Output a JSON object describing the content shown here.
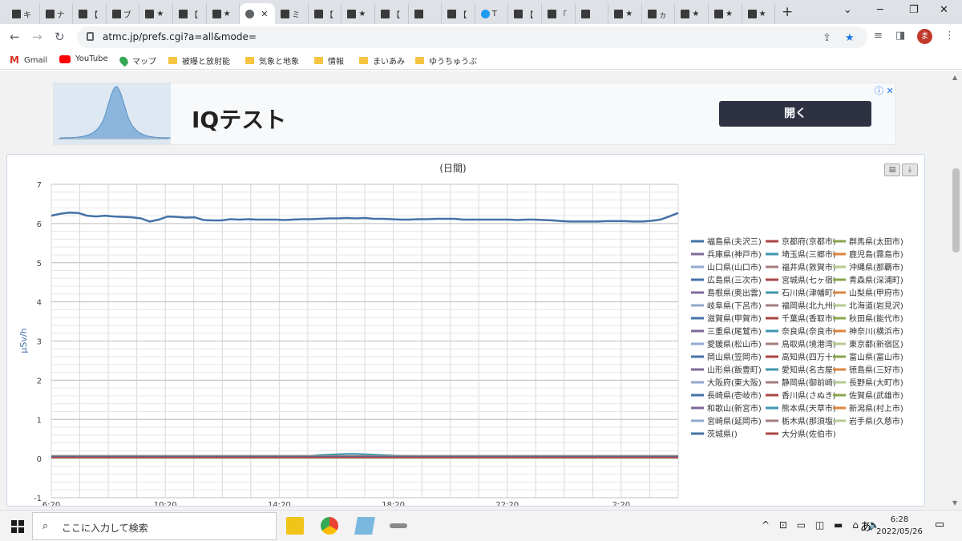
{
  "browser": {
    "tabs": [
      {
        "text": "キ",
        "icon": "app-tile-icon"
      },
      {
        "text": "ナ",
        "icon": "app-tile-icon"
      },
      {
        "text": "【",
        "icon": "app-tile-icon"
      },
      {
        "text": "ブ",
        "icon": "info-circle-icon"
      },
      {
        "text": "★",
        "icon": "app-tile-icon"
      },
      {
        "text": "【",
        "icon": "app-tile-icon"
      },
      {
        "text": "★",
        "icon": "app-tile-icon"
      },
      {
        "text": "",
        "icon": "globe-icon",
        "active": true
      },
      {
        "text": "ミ",
        "icon": "app-tile-icon"
      },
      {
        "text": "【",
        "icon": "app-tile-icon"
      },
      {
        "text": "★",
        "icon": "app-tile-icon"
      },
      {
        "text": "【",
        "icon": "app-tile-icon"
      },
      {
        "text": "",
        "icon": "app-tile-icon"
      },
      {
        "text": "【",
        "icon": "app-tile-icon"
      },
      {
        "text": "T",
        "icon": "twitter-icon"
      },
      {
        "text": "【",
        "icon": "app-tile-icon"
      },
      {
        "text": "「",
        "icon": "app-tile-icon"
      },
      {
        "text": "",
        "icon": "app-tile-icon"
      },
      {
        "text": "★",
        "icon": "app-tile-icon"
      },
      {
        "text": "ヵ",
        "icon": "app-tile-icon"
      },
      {
        "text": "★",
        "icon": "app-tile-icon"
      },
      {
        "text": "★",
        "icon": "app-tile-icon"
      },
      {
        "text": "★",
        "icon": "app-tile-icon"
      }
    ],
    "url": "atmc.jp/prefs.cgi?a=all&mode=",
    "avatar_letter": "ま",
    "bookmarks": [
      "Gmail",
      "YouTube",
      "マップ",
      "被曝と放射能",
      "気象と地象",
      "情報",
      "まいあみ",
      "ゆうちゅうぶ"
    ]
  },
  "ad": {
    "title": "IQテスト",
    "button": "開く"
  },
  "chart_data": {
    "type": "line",
    "title": "(日間)",
    "xlabel": "",
    "ylabel": "μSv/h",
    "ylim": [
      -1,
      7
    ],
    "yticks": [
      -1,
      0,
      1,
      2,
      3,
      4,
      5,
      6,
      7
    ],
    "x_tick_labels": [
      "6:20",
      "10:20",
      "14:20",
      "18:20",
      "22:20",
      "2:20"
    ],
    "grid": true,
    "legend_position": "right",
    "series": [
      {
        "name": "福島県(夫沢三)",
        "color": "#4572a7",
        "values": [
          6.2,
          6.25,
          6.28,
          6.27,
          6.2,
          6.18,
          6.2,
          6.18,
          6.17,
          6.16,
          6.13,
          6.05,
          6.1,
          6.18,
          6.17,
          6.15,
          6.16,
          6.09,
          6.08,
          6.08,
          6.11,
          6.1,
          6.11,
          6.1,
          6.1,
          6.1,
          6.09,
          6.1,
          6.11,
          6.11,
          6.12,
          6.13,
          6.13,
          6.14,
          6.13,
          6.14,
          6.12,
          6.12,
          6.11,
          6.1,
          6.1,
          6.11,
          6.11,
          6.12,
          6.12,
          6.12,
          6.1,
          6.1,
          6.1,
          6.1,
          6.1,
          6.1,
          6.09,
          6.1,
          6.1,
          6.09,
          6.08,
          6.06,
          6.05,
          6.05,
          6.05,
          6.05,
          6.06,
          6.06,
          6.06,
          6.05,
          6.05,
          6.07,
          6.1,
          6.18,
          6.27
        ]
      },
      {
        "name": "京都府(京都市)",
        "color": "#aa4643",
        "values": [
          0.04,
          0.04
        ]
      },
      {
        "name": "群馬県(太田市)",
        "color": "#89a54e",
        "values": [
          0.05,
          0.05
        ]
      },
      {
        "name": "兵庫県(神戸市)",
        "color": "#80699b",
        "values": [
          0.05,
          0.05
        ]
      },
      {
        "name": "埼玉県(三郷市)",
        "color": "#3d96ae",
        "values": [
          0.06,
          0.06
        ]
      },
      {
        "name": "鹿児島(霧島市)",
        "color": "#db843d",
        "values": [
          0.07,
          0.07
        ]
      },
      {
        "name": "山口県(山口市)",
        "color": "#92a8cd",
        "values": [
          0.07,
          0.07
        ]
      },
      {
        "name": "福井県(敦賀市)",
        "color": "#a47d7c",
        "values": [
          0.06,
          0.06
        ]
      },
      {
        "name": "沖縄県(那覇市)",
        "color": "#b5ca92",
        "values": [
          0.05,
          0.05
        ]
      },
      {
        "name": "広島県(三次市)",
        "color": "#4572a7",
        "values": [
          0.06,
          0.06
        ]
      },
      {
        "name": "宮城県(七ヶ宿)",
        "color": "#aa4643",
        "values": [
          0.05,
          0.05
        ]
      },
      {
        "name": "青森県(深浦町)",
        "color": "#89a54e",
        "values": [
          0.04,
          0.04
        ]
      },
      {
        "name": "島根県(奥出雲)",
        "color": "#80699b",
        "values": [
          0.06,
          0.06
        ]
      },
      {
        "name": "石川県(津幡町)",
        "color": "#3d96ae",
        "values": [
          0.06,
          0.06
        ]
      },
      {
        "name": "山梨県(甲府市)",
        "color": "#db843d",
        "values": [
          0.05,
          0.05
        ]
      },
      {
        "name": "岐阜県(下呂市)",
        "color": "#92a8cd",
        "values": [
          0.07,
          0.07
        ]
      },
      {
        "name": "福岡県(北九州)",
        "color": "#a47d7c",
        "values": [
          0.04,
          0.04
        ]
      },
      {
        "name": "北海道(岩見沢)",
        "color": "#b5ca92",
        "values": [
          0.03,
          0.03
        ]
      },
      {
        "name": "滋賀県(甲賀市)",
        "color": "#4572a7",
        "values": [
          0.05,
          0.05
        ]
      },
      {
        "name": "千葉県(香取市)",
        "color": "#aa4643",
        "values": [
          0.05,
          0.05
        ]
      },
      {
        "name": "秋田県(能代市)",
        "color": "#89a54e",
        "values": [
          0.06,
          0.06
        ]
      },
      {
        "name": "三重県(尾鷲市)",
        "color": "#80699b",
        "values": [
          0.05,
          0.05
        ]
      },
      {
        "name": "奈良県(奈良市)",
        "color": "#3d96ae",
        "values": [
          0.06,
          0.06
        ]
      },
      {
        "name": "神奈川(横浜市)",
        "color": "#db843d",
        "values": [
          0.04,
          0.04
        ]
      },
      {
        "name": "愛媛県(松山市)",
        "color": "#92a8cd",
        "values": [
          0.06,
          0.06
        ]
      },
      {
        "name": "鳥取県(境港湾)",
        "color": "#a47d7c",
        "values": [
          0.06,
          0.06
        ]
      },
      {
        "name": "東京都(新宿区)",
        "color": "#b5ca92",
        "values": [
          0.04,
          0.04
        ]
      },
      {
        "name": "岡山県(笠岡市)",
        "color": "#4572a7",
        "values": [
          0.05,
          0.05
        ]
      },
      {
        "name": "高知県(四万十)",
        "color": "#aa4643",
        "values": [
          0.05,
          0.05
        ]
      },
      {
        "name": "富山県(富山市)",
        "color": "#89a54e",
        "values": [
          0.06,
          0.06
        ]
      },
      {
        "name": "山形県(飯豊町)",
        "color": "#80699b",
        "values": [
          0.05,
          0.05
        ]
      },
      {
        "name": "愛知県(名古屋)",
        "color": "#3d96ae",
        "values": [
          0.05,
          0.05
        ]
      },
      {
        "name": "徳島県(三好市)",
        "color": "#db843d",
        "values": [
          0.06,
          0.06
        ]
      },
      {
        "name": "大阪府(東大阪)",
        "color": "#92a8cd",
        "values": [
          0.06,
          0.06
        ]
      },
      {
        "name": "静岡県(御前崎)",
        "color": "#a47d7c",
        "values": [
          0.05,
          0.05
        ]
      },
      {
        "name": "長野県(大町市)",
        "color": "#b5ca92",
        "values": [
          0.06,
          0.06
        ]
      },
      {
        "name": "長崎県(壱岐市)",
        "color": "#4572a7",
        "values": [
          0.05,
          0.05
        ]
      },
      {
        "name": "香川県(さぬき)",
        "color": "#aa4643",
        "values": [
          0.06,
          0.06
        ]
      },
      {
        "name": "佐賀県(武雄市)",
        "color": "#89a54e",
        "values": [
          0.06,
          0.06
        ]
      },
      {
        "name": "和歌山(新宮市)",
        "color": "#80699b",
        "values": [
          0.06,
          0.06
        ]
      },
      {
        "name": "熊本県(天草市)",
        "color": "#3d96ae",
        "values": [
          0.05,
          0.05,
          0.05,
          0.05,
          0.05,
          0.05,
          0.05,
          0.05,
          0.05,
          0.05,
          0.05,
          0.05,
          0.05,
          0.05,
          0.05,
          0.05,
          0.05,
          0.05,
          0.05,
          0.05,
          0.05,
          0.05,
          0.05,
          0.05,
          0.05,
          0.05,
          0.05,
          0.05,
          0.06,
          0.07,
          0.09,
          0.1,
          0.11,
          0.12,
          0.12,
          0.11,
          0.1,
          0.09,
          0.08,
          0.07,
          0.06,
          0.05,
          0.05,
          0.05,
          0.05,
          0.05,
          0.05,
          0.05,
          0.05,
          0.05,
          0.05,
          0.05,
          0.05,
          0.05,
          0.05,
          0.05,
          0.05,
          0.05,
          0.05,
          0.05,
          0.05,
          0.05,
          0.05,
          0.05,
          0.05,
          0.05,
          0.05,
          0.05,
          0.05,
          0.05,
          0.05
        ]
      },
      {
        "name": "新潟県(村上市)",
        "color": "#db843d",
        "values": [
          0.06,
          0.06
        ]
      },
      {
        "name": "宮崎県(延岡市)",
        "color": "#92a8cd",
        "values": [
          0.05,
          0.05
        ]
      },
      {
        "name": "栃木県(那須塩)",
        "color": "#a47d7c",
        "values": [
          0.06,
          0.06
        ]
      },
      {
        "name": "岩手県(久慈市)",
        "color": "#b5ca92",
        "values": [
          0.05,
          0.05
        ]
      },
      {
        "name": "茨城県()",
        "color": "#4572a7",
        "values": [
          0.05,
          0.05
        ]
      },
      {
        "name": "大分県(佐伯市)",
        "color": "#aa4643",
        "values": [
          0.03,
          0.03
        ]
      }
    ]
  },
  "taskbar": {
    "search_placeholder": "ここに入力して検索",
    "ime": "あ",
    "time": "6:28",
    "date": "2022/05/26"
  }
}
